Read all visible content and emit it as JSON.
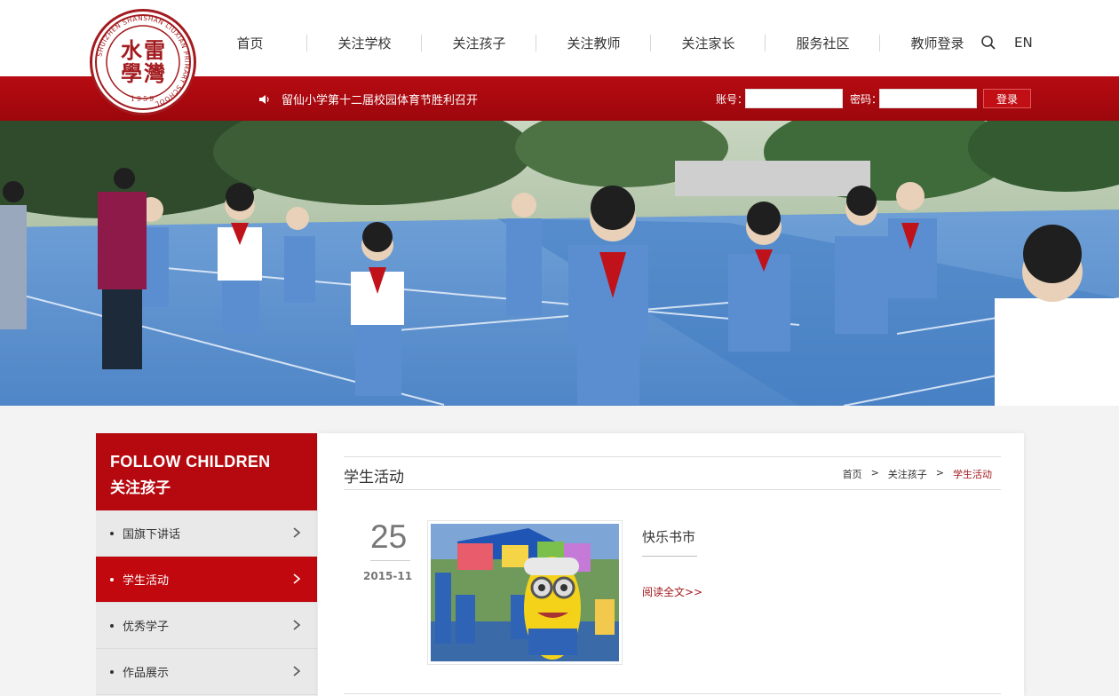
{
  "brand": {
    "logo_glyph": "水雷學灣",
    "logo_ring_text": "SHUIZHEN SHANSHAN LIUXIAN PRIMARY SCHOOL",
    "logo_year": "1959",
    "color": "#a31b1f"
  },
  "nav": {
    "items": [
      {
        "label": "首页"
      },
      {
        "label": "关注学校"
      },
      {
        "label": "关注孩子"
      },
      {
        "label": "关注教师"
      },
      {
        "label": "关注家长"
      },
      {
        "label": "服务社区"
      },
      {
        "label": "教师登录"
      }
    ],
    "search_icon": "search-icon",
    "lang_label": "EN"
  },
  "notice_bar": {
    "icon": "speaker-icon",
    "text": "留仙小学第十二届校园体育节胜利召开",
    "account_label": "账号：",
    "account_value": "",
    "password_label": "密码：",
    "password_value": "",
    "login_label": "登录",
    "color": "#b5090f"
  },
  "sidebar": {
    "title_en": "FOLLOW CHILDREN",
    "title_cn": "关注孩子",
    "items": [
      {
        "label": "国旗下讲话",
        "active": false
      },
      {
        "label": "学生活动",
        "active": true
      },
      {
        "label": "优秀学子",
        "active": false
      },
      {
        "label": "作品展示",
        "active": false
      }
    ]
  },
  "content": {
    "section_title": "学生活动",
    "breadcrumb": [
      "首页",
      ">",
      "关注孩子",
      ">",
      "学生活动"
    ],
    "articles": [
      {
        "day": "25",
        "year_month": "2015-11",
        "title": "快乐书市",
        "read_more": "阅读全文>>"
      }
    ]
  }
}
